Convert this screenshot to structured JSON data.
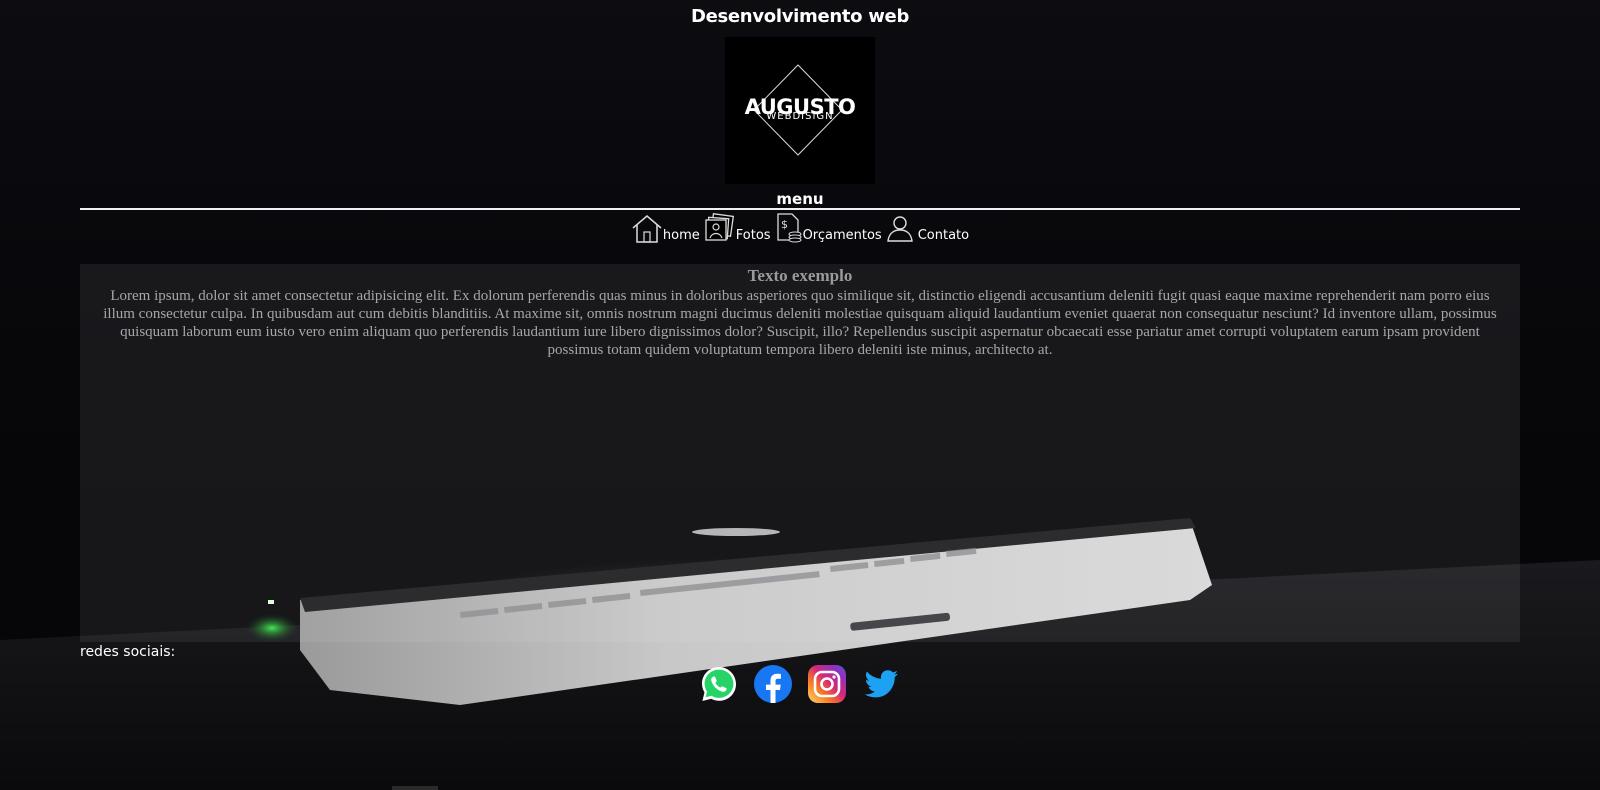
{
  "header": {
    "title": "Desenvolvimento web",
    "logo_main": "AUGUSTO",
    "logo_sub": "WEBDISIGN"
  },
  "menu": {
    "heading": "menu",
    "items": [
      {
        "label": "home",
        "icon": "home-icon"
      },
      {
        "label": "Fotos",
        "icon": "photos-icon"
      },
      {
        "label": "Orçamentos",
        "icon": "budget-icon"
      },
      {
        "label": "Contato",
        "icon": "contact-icon"
      }
    ]
  },
  "content": {
    "title": "Texto exemplo",
    "body": "Lorem ipsum, dolor sit amet consectetur adipisicing elit. Ex dolorum perferendis quas minus in doloribus asperiores quo similique sit, distinctio eligendi accusantium deleniti fugit quasi eaque maxime reprehenderit nam porro eius illum consectetur culpa. In quibusdam aut cum debitis blanditiis. At maxime sit, omnis nostrum magni ducimus deleniti molestiae quisquam aliquid laudantium eveniet quaerat non consequatur nesciunt? Id inventore ullam, possimus quisquam laborum eum iusto vero enim aliquam quo perferendis laudantium iure libero dignissimos dolor? Suscipit, illo? Repellendus suscipit aspernatur obcaecati esse pariatur amet corrupti voluptatem earum ipsam provident possimus totam quidem voluptatum tempora libero deleniti iste minus, architecto at."
  },
  "social": {
    "label": "redes sociais:",
    "icons": [
      "whatsapp-icon",
      "facebook-icon",
      "instagram-icon",
      "twitter-icon"
    ]
  },
  "colors": {
    "background": "#050507",
    "text": "#ffffff",
    "content_text": "#a6a6a6",
    "whatsapp": "#25D366",
    "facebook": "#1877F2",
    "twitter": "#1DA1F2"
  }
}
